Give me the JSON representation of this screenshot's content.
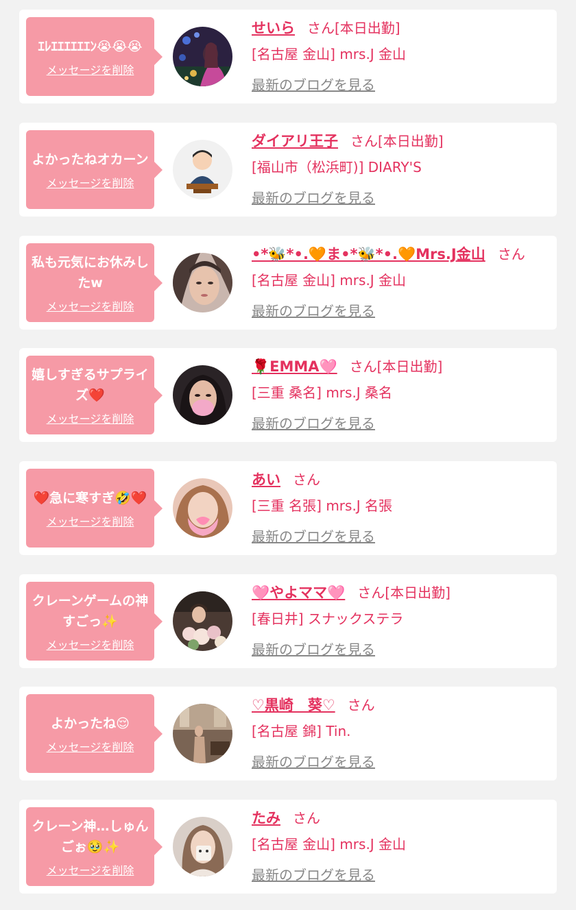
{
  "cards": [
    {
      "message": "ｴﾚｴｴｴｴｴｴﾝ😭😭😭",
      "delete_label": "メッセージを削除",
      "name": "せいら",
      "suffix": "さん[本日出勤]",
      "shop": "[名古屋 金山] mrs.J 金山",
      "blog_link": "最新のブログを見る",
      "avatar_color": "#2b2140"
    },
    {
      "message": "よかったねオカーン",
      "delete_label": "メッセージを削除",
      "name": "ダイアリ王子",
      "suffix": "さん[本日出勤]",
      "shop": "[福山市（松浜町)] DIARY'S",
      "blog_link": "最新のブログを見る",
      "avatar_color": "#f1f1f1"
    },
    {
      "message": "私も元気にお休みしたw",
      "delete_label": "メッセージを削除",
      "name": "•*🐝*•.🧡ま•*🐝*•.🧡Mrs.J金山",
      "suffix": "さん",
      "shop": "[名古屋 金山] mrs.J 金山",
      "blog_link": "最新のブログを見る",
      "avatar_color": "#8a6f68"
    },
    {
      "message": "嬉しすぎるサプライズ❤️",
      "delete_label": "メッセージを削除",
      "name": "🌹EMMA🩷",
      "suffix": "さん[本日出勤]",
      "shop": "[三重 桑名] mrs.J 桑名",
      "blog_link": "最新のブログを見る",
      "avatar_color": "#2a2326"
    },
    {
      "message": "❤️急に寒すぎ🤣❤️",
      "delete_label": "メッセージを削除",
      "name": "あい",
      "suffix": "さん",
      "shop": "[三重 名張] mrs.J 名張",
      "blog_link": "最新のブログを見る",
      "avatar_color": "#e9c7b8"
    },
    {
      "message": "クレーンゲームの神すごっ✨",
      "delete_label": "メッセージを削除",
      "name": "🩷やよママ🩷",
      "suffix": "さん[本日出勤]",
      "shop": "[春日井] スナックステラ",
      "blog_link": "最新のブログを見る",
      "avatar_color": "#4a3a33"
    },
    {
      "message": "よかったね😌",
      "delete_label": "メッセージを削除",
      "name": "♡黒崎　葵♡",
      "suffix": "さん",
      "shop": "[名古屋 錦] Tin.",
      "blog_link": "最新のブログを見る",
      "avatar_color": "#7a6454"
    },
    {
      "message": "クレーン神…しゅんごぉ🥹✨",
      "delete_label": "メッセージを削除",
      "name": "たみ",
      "suffix": "さん",
      "shop": "[名古屋 金山] mrs.J 金山",
      "blog_link": "最新のブログを見る",
      "avatar_color": "#d9cfc8"
    }
  ]
}
